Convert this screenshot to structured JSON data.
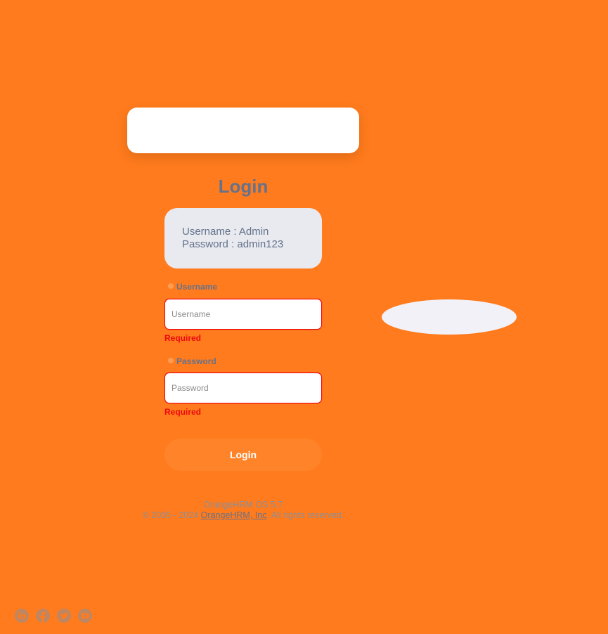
{
  "login": {
    "title": "Login",
    "credentials": {
      "username_hint": "Username : Admin",
      "password_hint": "Password : admin123"
    },
    "username": {
      "label": "Username",
      "placeholder": "Username",
      "value": "",
      "error": "Required"
    },
    "password": {
      "label": "Password",
      "placeholder": "Password",
      "value": "",
      "error": "Required"
    },
    "submit_label": "Login"
  },
  "footer": {
    "version": "OrangeHRM OS 5.7",
    "copyright_prefix": "© 2005 - 2024 ",
    "company_link": "OrangeHRM, Inc",
    "copyright_suffix": ". All rights reserved."
  },
  "social": {
    "icons": [
      "linkedin-icon",
      "facebook-icon",
      "twitter-icon",
      "youtube-icon"
    ]
  },
  "colors": {
    "background": "#ff7b1d",
    "text": "#64728c",
    "error": "#eb0910",
    "button": "#ff8329",
    "credential_box": "#e8eaef"
  }
}
